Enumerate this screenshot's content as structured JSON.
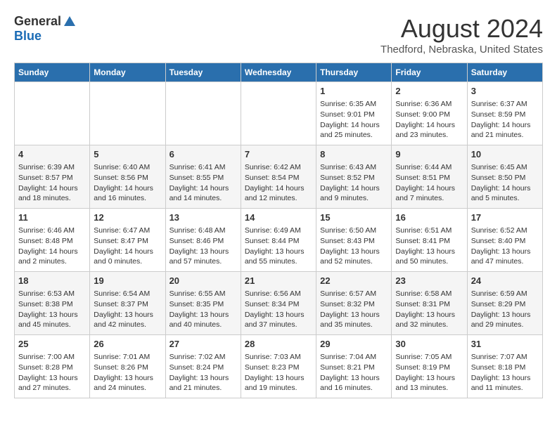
{
  "header": {
    "logo_general": "General",
    "logo_blue": "Blue",
    "month_year": "August 2024",
    "location": "Thedford, Nebraska, United States"
  },
  "days_of_week": [
    "Sunday",
    "Monday",
    "Tuesday",
    "Wednesday",
    "Thursday",
    "Friday",
    "Saturday"
  ],
  "weeks": [
    [
      {
        "day": "",
        "content": ""
      },
      {
        "day": "",
        "content": ""
      },
      {
        "day": "",
        "content": ""
      },
      {
        "day": "",
        "content": ""
      },
      {
        "day": "1",
        "sunrise": "Sunrise: 6:35 AM",
        "sunset": "Sunset: 9:01 PM",
        "daylight": "Daylight: 14 hours and 25 minutes."
      },
      {
        "day": "2",
        "sunrise": "Sunrise: 6:36 AM",
        "sunset": "Sunset: 9:00 PM",
        "daylight": "Daylight: 14 hours and 23 minutes."
      },
      {
        "day": "3",
        "sunrise": "Sunrise: 6:37 AM",
        "sunset": "Sunset: 8:59 PM",
        "daylight": "Daylight: 14 hours and 21 minutes."
      }
    ],
    [
      {
        "day": "4",
        "sunrise": "Sunrise: 6:39 AM",
        "sunset": "Sunset: 8:57 PM",
        "daylight": "Daylight: 14 hours and 18 minutes."
      },
      {
        "day": "5",
        "sunrise": "Sunrise: 6:40 AM",
        "sunset": "Sunset: 8:56 PM",
        "daylight": "Daylight: 14 hours and 16 minutes."
      },
      {
        "day": "6",
        "sunrise": "Sunrise: 6:41 AM",
        "sunset": "Sunset: 8:55 PM",
        "daylight": "Daylight: 14 hours and 14 minutes."
      },
      {
        "day": "7",
        "sunrise": "Sunrise: 6:42 AM",
        "sunset": "Sunset: 8:54 PM",
        "daylight": "Daylight: 14 hours and 12 minutes."
      },
      {
        "day": "8",
        "sunrise": "Sunrise: 6:43 AM",
        "sunset": "Sunset: 8:52 PM",
        "daylight": "Daylight: 14 hours and 9 minutes."
      },
      {
        "day": "9",
        "sunrise": "Sunrise: 6:44 AM",
        "sunset": "Sunset: 8:51 PM",
        "daylight": "Daylight: 14 hours and 7 minutes."
      },
      {
        "day": "10",
        "sunrise": "Sunrise: 6:45 AM",
        "sunset": "Sunset: 8:50 PM",
        "daylight": "Daylight: 14 hours and 5 minutes."
      }
    ],
    [
      {
        "day": "11",
        "sunrise": "Sunrise: 6:46 AM",
        "sunset": "Sunset: 8:48 PM",
        "daylight": "Daylight: 14 hours and 2 minutes."
      },
      {
        "day": "12",
        "sunrise": "Sunrise: 6:47 AM",
        "sunset": "Sunset: 8:47 PM",
        "daylight": "Daylight: 14 hours and 0 minutes."
      },
      {
        "day": "13",
        "sunrise": "Sunrise: 6:48 AM",
        "sunset": "Sunset: 8:46 PM",
        "daylight": "Daylight: 13 hours and 57 minutes."
      },
      {
        "day": "14",
        "sunrise": "Sunrise: 6:49 AM",
        "sunset": "Sunset: 8:44 PM",
        "daylight": "Daylight: 13 hours and 55 minutes."
      },
      {
        "day": "15",
        "sunrise": "Sunrise: 6:50 AM",
        "sunset": "Sunset: 8:43 PM",
        "daylight": "Daylight: 13 hours and 52 minutes."
      },
      {
        "day": "16",
        "sunrise": "Sunrise: 6:51 AM",
        "sunset": "Sunset: 8:41 PM",
        "daylight": "Daylight: 13 hours and 50 minutes."
      },
      {
        "day": "17",
        "sunrise": "Sunrise: 6:52 AM",
        "sunset": "Sunset: 8:40 PM",
        "daylight": "Daylight: 13 hours and 47 minutes."
      }
    ],
    [
      {
        "day": "18",
        "sunrise": "Sunrise: 6:53 AM",
        "sunset": "Sunset: 8:38 PM",
        "daylight": "Daylight: 13 hours and 45 minutes."
      },
      {
        "day": "19",
        "sunrise": "Sunrise: 6:54 AM",
        "sunset": "Sunset: 8:37 PM",
        "daylight": "Daylight: 13 hours and 42 minutes."
      },
      {
        "day": "20",
        "sunrise": "Sunrise: 6:55 AM",
        "sunset": "Sunset: 8:35 PM",
        "daylight": "Daylight: 13 hours and 40 minutes."
      },
      {
        "day": "21",
        "sunrise": "Sunrise: 6:56 AM",
        "sunset": "Sunset: 8:34 PM",
        "daylight": "Daylight: 13 hours and 37 minutes."
      },
      {
        "day": "22",
        "sunrise": "Sunrise: 6:57 AM",
        "sunset": "Sunset: 8:32 PM",
        "daylight": "Daylight: 13 hours and 35 minutes."
      },
      {
        "day": "23",
        "sunrise": "Sunrise: 6:58 AM",
        "sunset": "Sunset: 8:31 PM",
        "daylight": "Daylight: 13 hours and 32 minutes."
      },
      {
        "day": "24",
        "sunrise": "Sunrise: 6:59 AM",
        "sunset": "Sunset: 8:29 PM",
        "daylight": "Daylight: 13 hours and 29 minutes."
      }
    ],
    [
      {
        "day": "25",
        "sunrise": "Sunrise: 7:00 AM",
        "sunset": "Sunset: 8:28 PM",
        "daylight": "Daylight: 13 hours and 27 minutes."
      },
      {
        "day": "26",
        "sunrise": "Sunrise: 7:01 AM",
        "sunset": "Sunset: 8:26 PM",
        "daylight": "Daylight: 13 hours and 24 minutes."
      },
      {
        "day": "27",
        "sunrise": "Sunrise: 7:02 AM",
        "sunset": "Sunset: 8:24 PM",
        "daylight": "Daylight: 13 hours and 21 minutes."
      },
      {
        "day": "28",
        "sunrise": "Sunrise: 7:03 AM",
        "sunset": "Sunset: 8:23 PM",
        "daylight": "Daylight: 13 hours and 19 minutes."
      },
      {
        "day": "29",
        "sunrise": "Sunrise: 7:04 AM",
        "sunset": "Sunset: 8:21 PM",
        "daylight": "Daylight: 13 hours and 16 minutes."
      },
      {
        "day": "30",
        "sunrise": "Sunrise: 7:05 AM",
        "sunset": "Sunset: 8:19 PM",
        "daylight": "Daylight: 13 hours and 13 minutes."
      },
      {
        "day": "31",
        "sunrise": "Sunrise: 7:07 AM",
        "sunset": "Sunset: 8:18 PM",
        "daylight": "Daylight: 13 hours and 11 minutes."
      }
    ]
  ]
}
